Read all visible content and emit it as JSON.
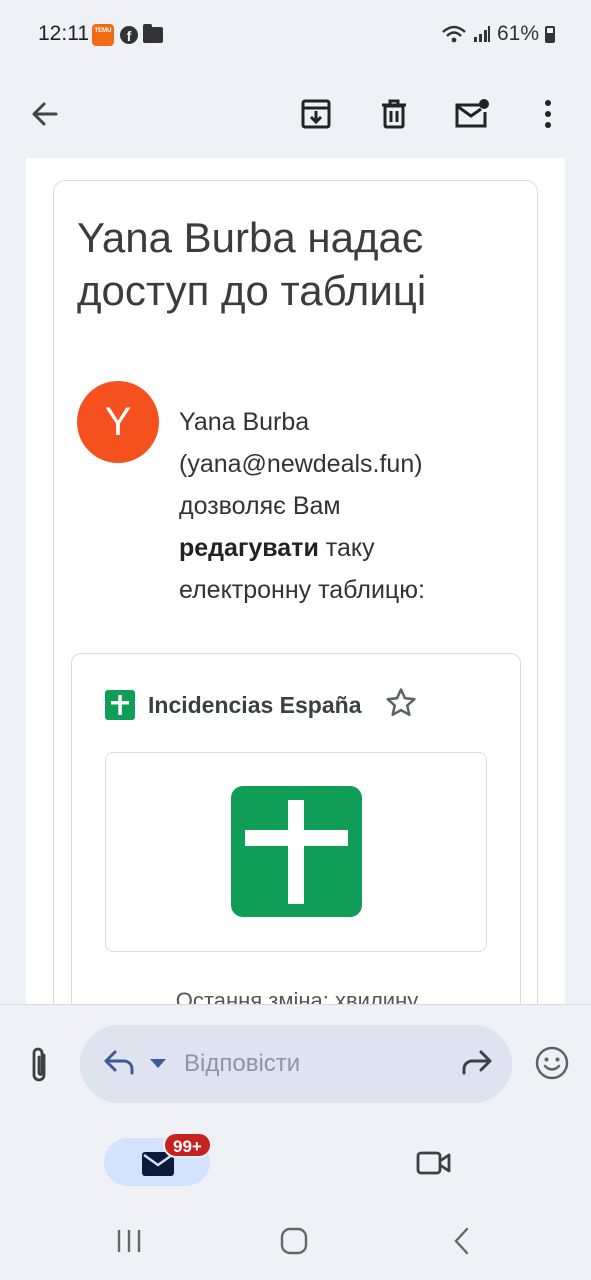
{
  "status_bar": {
    "time": "12:11",
    "battery": "61%",
    "temu_label": "TEMU",
    "fb_glyph": "f"
  },
  "toolbar": {
    "back": "arrow-left-icon",
    "archive": "archive-icon",
    "delete": "trash-icon",
    "mark_unread": "mark-unread-icon",
    "more": "more-vert-icon"
  },
  "email": {
    "title": "Yana Burba надає доступ до таблиці",
    "avatar_letter": "Y",
    "sender_name": "Yana Burba",
    "sender_email": "(yana@newdeals.fun)",
    "msg_part1": "дозволяє Вам",
    "msg_bold": "редагувати",
    "msg_part2": "таку електронну таблицю:",
    "file_name": "Incidencias España",
    "modified_text": "Остання зміна: хвилину"
  },
  "reply_bar": {
    "placeholder": "Відповісти"
  },
  "bottom_nav": {
    "mail_badge": "99+"
  },
  "colors": {
    "sheets_green": "#0f9d58",
    "avatar_bg": "#f4511e",
    "badge_red": "#c5221f"
  }
}
